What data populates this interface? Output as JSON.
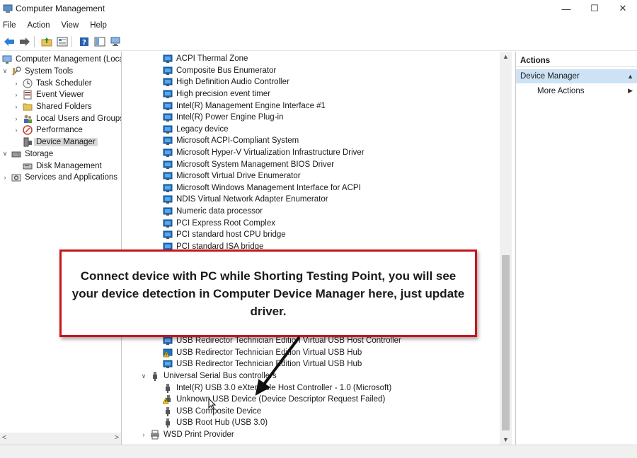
{
  "window": {
    "title": "Computer Management",
    "minimize_glyph": "—",
    "maximize_glyph": "☐",
    "close_glyph": "✕"
  },
  "menu": [
    "File",
    "Action",
    "View",
    "Help"
  ],
  "toolbar": {
    "buttons": [
      "back-icon",
      "forward-icon",
      "up-folder-icon",
      "properties-icon",
      "help-icon",
      "console-tree-icon",
      "computer-icon"
    ]
  },
  "left_tree": {
    "items": [
      {
        "label": "Computer Management (Local",
        "level": 0,
        "expander": "",
        "icon": "computer-management-icon"
      },
      {
        "label": "System Tools",
        "level": 1,
        "expander": "v",
        "icon": "system-tools-icon"
      },
      {
        "label": "Task Scheduler",
        "level": 2,
        "expander": ">",
        "icon": "clock-icon"
      },
      {
        "label": "Event Viewer",
        "level": 2,
        "expander": ">",
        "icon": "event-viewer-icon"
      },
      {
        "label": "Shared Folders",
        "level": 2,
        "expander": ">",
        "icon": "folder-icon"
      },
      {
        "label": "Local Users and Groups",
        "level": 2,
        "expander": ">",
        "icon": "users-icon"
      },
      {
        "label": "Performance",
        "level": 2,
        "expander": ">",
        "icon": "performance-icon"
      },
      {
        "label": "Device Manager",
        "level": 2,
        "expander": "",
        "icon": "device-manager-icon",
        "selected": true
      },
      {
        "label": "Storage",
        "level": 1,
        "expander": "v",
        "icon": "storage-icon"
      },
      {
        "label": "Disk Management",
        "level": 2,
        "expander": "",
        "icon": "disk-icon"
      },
      {
        "label": "Services and Applications",
        "level": 1,
        "expander": ">",
        "icon": "services-icon"
      }
    ]
  },
  "device_list": {
    "items_top": [
      {
        "label": "ACPI Thermal Zone",
        "icon": "system-device-icon"
      },
      {
        "label": "Composite Bus Enumerator",
        "icon": "system-device-icon"
      },
      {
        "label": "High Definition Audio Controller",
        "icon": "system-device-icon"
      },
      {
        "label": "High precision event timer",
        "icon": "system-device-icon"
      },
      {
        "label": "Intel(R) Management Engine Interface #1",
        "icon": "system-device-icon"
      },
      {
        "label": "Intel(R) Power Engine Plug-in",
        "icon": "system-device-icon"
      },
      {
        "label": "Legacy device",
        "icon": "system-device-icon"
      },
      {
        "label": "Microsoft ACPI-Compliant System",
        "icon": "system-device-icon"
      },
      {
        "label": "Microsoft Hyper-V Virtualization Infrastructure Driver",
        "icon": "system-device-icon"
      },
      {
        "label": "Microsoft System Management BIOS Driver",
        "icon": "system-device-icon"
      },
      {
        "label": "Microsoft Virtual Drive Enumerator",
        "icon": "system-device-icon"
      },
      {
        "label": "Microsoft Windows Management Interface for ACPI",
        "icon": "system-device-icon"
      },
      {
        "label": "NDIS Virtual Network Adapter Enumerator",
        "icon": "system-device-icon"
      },
      {
        "label": "Numeric data processor",
        "icon": "system-device-icon"
      },
      {
        "label": "PCI Express Root Complex",
        "icon": "system-device-icon"
      },
      {
        "label": "PCI standard host CPU bridge",
        "icon": "system-device-icon"
      },
      {
        "label": "PCI standard ISA bridge",
        "icon": "system-device-icon"
      }
    ],
    "items_bottom": [
      {
        "label": "USB Redirector Technician Edition Virtual USB Host Controller",
        "icon": "system-device-icon",
        "indent": 1
      },
      {
        "label": "USB Redirector Technician Edition Virtual USB Hub",
        "icon": "warning-device-icon",
        "indent": 1
      },
      {
        "label": "USB Redirector Technician Edition Virtual USB Hub",
        "icon": "system-device-icon",
        "indent": 1
      },
      {
        "label": "Universal Serial Bus controllers",
        "icon": "usb-plug-icon",
        "indent": 0,
        "expander": "v"
      },
      {
        "label": "Intel(R) USB 3.0 eXtensible Host Controller - 1.0 (Microsoft)",
        "icon": "usb-plug-icon",
        "indent": 1
      },
      {
        "label": "Unknown USB Device (Device Descriptor Request Failed)",
        "icon": "warning-usb-icon",
        "indent": 1
      },
      {
        "label": "USB Composite Device",
        "icon": "usb-plug-icon",
        "indent": 1
      },
      {
        "label": "USB Root Hub (USB 3.0)",
        "icon": "usb-plug-icon",
        "indent": 1
      },
      {
        "label": "WSD Print Provider",
        "icon": "printer-icon",
        "indent": 0,
        "expander": ">"
      }
    ]
  },
  "actions": {
    "header": "Actions",
    "section": "Device Manager",
    "more": "More Actions"
  },
  "callout": {
    "text": "Connect device with PC while Shorting Testing Point, you will see your device detection in Computer Device Manager here, just update driver."
  },
  "colors": {
    "callout_border": "#c8141e",
    "selection": "#cde3f5",
    "device_icon": "#1e73be"
  }
}
